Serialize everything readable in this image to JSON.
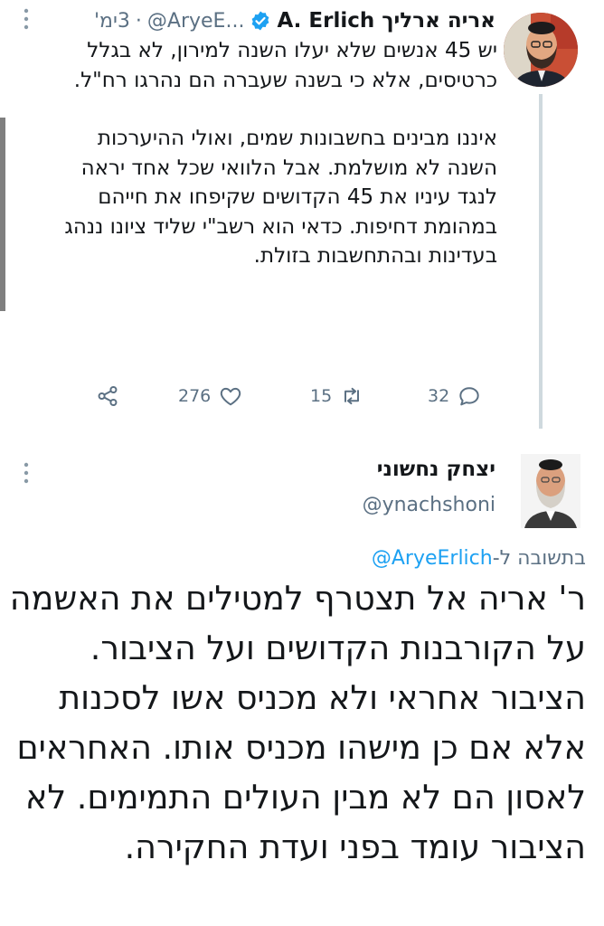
{
  "tweet1": {
    "display_name": "A. Erlich אריה ארליך",
    "handle": "@AryeE...",
    "separator": "·",
    "time": "3ימ'",
    "paragraphs": [
      "יש 45 אנשים שלא יעלו השנה למירון, לא בגלל כרטיסים, אלא כי בשנה שעברה הם נהרגו רח\"ל.",
      "איננו מבינים בחשבונות שמים, ואולי ההיערכות השנה לא מושלמת. אבל הלוואי שכל אחד יראה לנגד עיניו את 45 הקדושים שקיפחו את חייהם במהומת דחיפות. כדאי הוא רשב\"י שליד ציונו ננהג בעדינות ובהתחשבות בזולת."
    ],
    "actions": {
      "replies": "32",
      "retweets": "15",
      "likes": "276"
    },
    "icons": [
      "reply-icon",
      "retweet-icon",
      "like-icon",
      "share-icon",
      "verified-badge-icon",
      "more-options-icon"
    ]
  },
  "tweet2": {
    "display_name": "יצחק נחשוני",
    "handle": "@ynachshoni",
    "reply_prefix": "בתשובה ל-",
    "reply_handle": "@AryeErlich",
    "body": "ר' אריה אל תצטרף למטילים את האשמה על הקורבנות הקדושים ועל הציבור. הציבור אחראי ולא מכניס אשו לסכנות אלא אם כן מישהו מכניס אותו. האחראים לאסון הם לא מבין העולים התמימים. לא הציבור עומד בפני ועדת החקירה."
  },
  "colors": {
    "text": "#14171a",
    "secondary": "#5b7083",
    "link": "#1da1f2",
    "verified": "#1da1f2",
    "thread_line": "#cfd9de"
  }
}
